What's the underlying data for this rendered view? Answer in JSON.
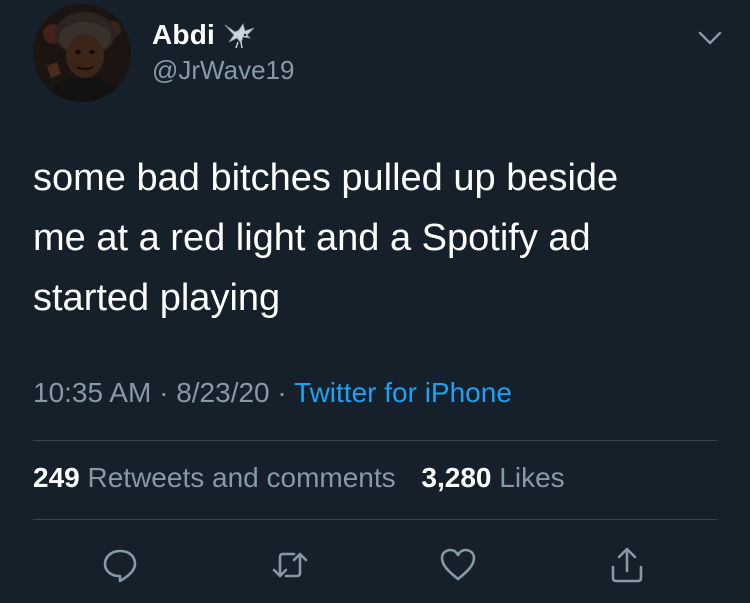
{
  "user": {
    "display_name": "Abdi",
    "handle": "@JrWave19",
    "name_emoji_icon": "eagle-icon",
    "avatar_icon": "avatar"
  },
  "tweet": {
    "text": "some bad bitches pulled up beside\nme at a red light and a Spotify ad\nstarted playing"
  },
  "meta": {
    "time": "10:35 AM",
    "separator": " · ",
    "date": "8/23/20",
    "source": "Twitter for iPhone"
  },
  "stats": {
    "retweets_count": "249",
    "retweets_label": "Retweets and comments",
    "likes_count": "3,280",
    "likes_label": "Likes"
  },
  "actions": [
    "reply-icon",
    "retweet-icon",
    "like-icon",
    "share-icon"
  ],
  "colors": {
    "background": "#15202b",
    "text": "#ffffff",
    "secondary": "#8899a6",
    "accent": "#1da1f2",
    "divider": "#38444d"
  }
}
